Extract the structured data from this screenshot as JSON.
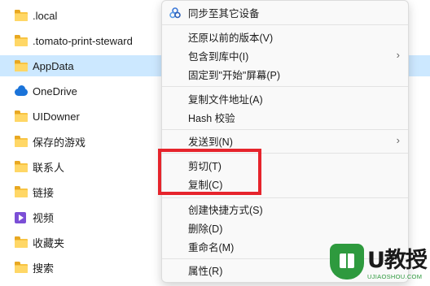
{
  "file_list": [
    {
      "name": ".local",
      "icon": "folder-icon",
      "selected": false
    },
    {
      "name": ".tomato-print-steward",
      "icon": "folder-icon",
      "selected": false
    },
    {
      "name": "AppData",
      "icon": "folder-icon",
      "selected": true
    },
    {
      "name": "OneDrive",
      "icon": "onedrive-cloud-icon",
      "selected": false
    },
    {
      "name": "UIDowner",
      "icon": "folder-icon",
      "selected": false
    },
    {
      "name": "保存的游戏",
      "icon": "folder-icon",
      "selected": false
    },
    {
      "name": "联系人",
      "icon": "folder-icon",
      "selected": false
    },
    {
      "name": "链接",
      "icon": "folder-icon",
      "selected": false
    },
    {
      "name": "视频",
      "icon": "video-icon",
      "selected": false
    },
    {
      "name": "收藏夹",
      "icon": "folder-icon",
      "selected": false
    },
    {
      "name": "搜索",
      "icon": "folder-icon",
      "selected": false
    }
  ],
  "context_menu": {
    "items": [
      {
        "label": "同步至其它设备",
        "icon": "sync-devices-icon",
        "submenu": false
      },
      {
        "label": "还原以前的版本(V)",
        "submenu": false
      },
      {
        "label": "包含到库中(I)",
        "submenu": true
      },
      {
        "label": "固定到\"开始\"屏幕(P)",
        "submenu": false
      },
      {
        "label": "复制文件地址(A)",
        "submenu": false
      },
      {
        "label": "Hash 校验",
        "submenu": false
      },
      {
        "label": "发送到(N)",
        "submenu": true
      },
      {
        "label": "剪切(T)",
        "submenu": false
      },
      {
        "label": "复制(C)",
        "submenu": false
      },
      {
        "label": "创建快捷方式(S)",
        "submenu": false
      },
      {
        "label": "删除(D)",
        "submenu": false
      },
      {
        "label": "重命名(M)",
        "submenu": false
      },
      {
        "label": "属性(R)",
        "submenu": false
      }
    ]
  },
  "highlight": {
    "color": "#e6242c",
    "covers": [
      "剪切(T)",
      "复制(C)"
    ]
  },
  "watermark": {
    "title": "U教授",
    "url": "UJIAOSHOU.COM",
    "badge_color": "#2e9a3e"
  },
  "colors": {
    "selection": "#cce8ff",
    "folder": "#f8c443",
    "menu_bg": "#f9f9f9"
  }
}
